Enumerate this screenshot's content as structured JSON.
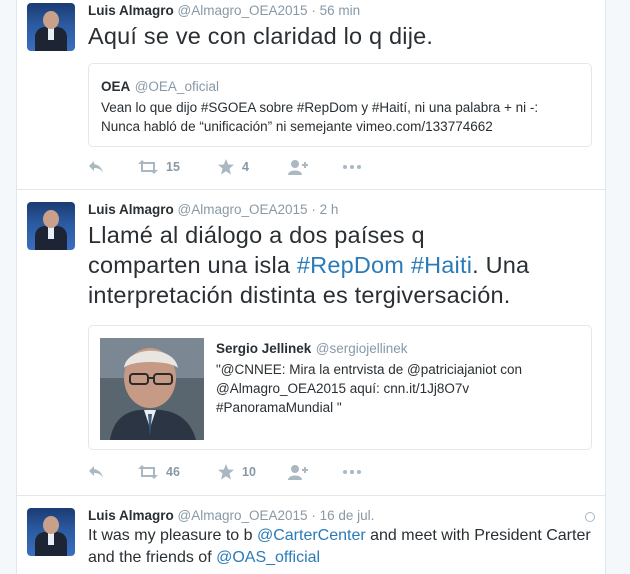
{
  "tweets": [
    {
      "name": "Luis Almagro",
      "handle": "@Almagro_OEA2015",
      "separator": "·",
      "time": "56 min",
      "text": "Aquí se ve con claridad lo q dije.",
      "quote": {
        "name": "OEA",
        "handle": "@OEA_oficial",
        "line1": "Vean lo que dijo #SGOEA sobre #RepDom y #Haití, ni una palabra + ni -:",
        "line2": "Nunca habló de “unificación” ni semejante vimeo.com/133774662"
      },
      "retweets": "15",
      "likes": "4"
    },
    {
      "name": "Luis Almagro",
      "handle": "@Almagro_OEA2015",
      "separator": "·",
      "time": "2 h",
      "line1": "Llamé al diálogo a dos países q",
      "line2_pre": "comparten una isla ",
      "line2_tag1": "#RepDom",
      "line2_space": " ",
      "line2_tag2": "#Haiti",
      "line2_post": ". Una",
      "line3": "interpretación distinta es tergiversación.",
      "quote": {
        "name": "Sergio Jellinek",
        "handle": "@sergiojellinek",
        "line1": "\"@CNNEE: Mira la entrvista de @patriciajaniot con",
        "line2": "@Almagro_OEA2015 aquí: cnn.it/1Jj8O7v",
        "line3": "#PanoramaMundial \""
      },
      "retweets": "46",
      "likes": "10"
    },
    {
      "name": "Luis Almagro",
      "handle": "@Almagro_OEA2015",
      "separator": "·",
      "time": "16 de jul.",
      "line1_pre": "It was my pleasure to b ",
      "line1_link": "@CarterCenter",
      "line1_post": " and meet with President Carter",
      "line2_pre": "and the friends of ",
      "line2_link": "@OAS_official"
    }
  ],
  "colors": {
    "link": "#2b7bb9",
    "text": "#292f33",
    "muted": "#8899a6",
    "icon": "#aab8c2",
    "border": "#e1e8ed"
  },
  "icons": [
    "reply-icon",
    "retweet-icon",
    "like-star-icon",
    "follow-icon",
    "more-icon",
    "globe-icon"
  ]
}
